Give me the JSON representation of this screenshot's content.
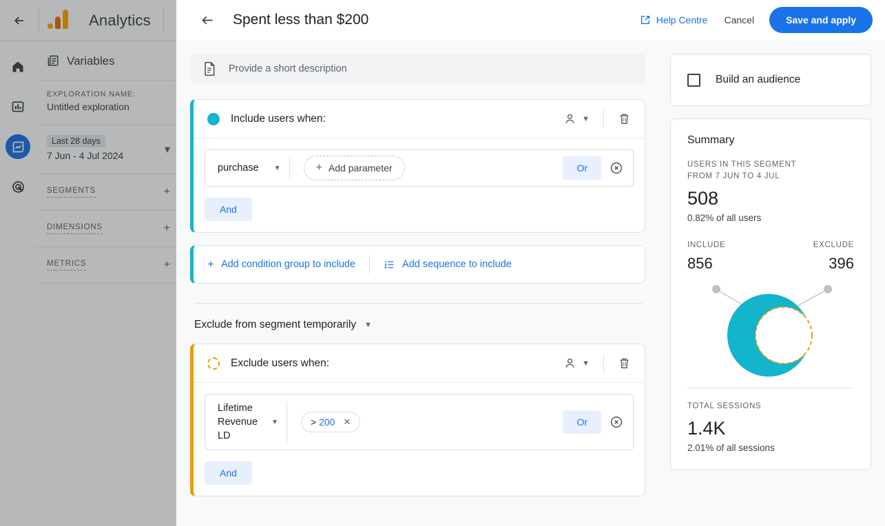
{
  "app": {
    "back_label": "back-arrow",
    "brand": "Analytics",
    "rail": [
      {
        "name": "home-icon",
        "label": "Home"
      },
      {
        "name": "reports-icon",
        "label": "Reports"
      },
      {
        "name": "explore-icon",
        "label": "Explore"
      },
      {
        "name": "advertising-icon",
        "label": "Advertising"
      }
    ],
    "variables": {
      "header": "Variables",
      "exploration_name_label": "EXPLORATION NAME:",
      "exploration_name_value": "Untitled exploration",
      "date_chip": "Last 28 days",
      "date_range": "7 Jun - 4 Jul 2024",
      "sections": [
        "SEGMENTS",
        "DIMENSIONS",
        "METRICS"
      ]
    }
  },
  "modal": {
    "title": "Spent less than $200",
    "help_label": "Help Centre",
    "cancel_label": "Cancel",
    "save_label": "Save and apply",
    "description_placeholder": "Provide a short description"
  },
  "include_group": {
    "header_label": "Include users when:",
    "scope_icon": "person-icon",
    "delete_icon": "trash-icon",
    "condition": {
      "dimension": "purchase",
      "add_parameter_label": "Add parameter",
      "or_label": "Or",
      "remove_label": "remove-condition"
    },
    "and_label": "And"
  },
  "add_group_bar": {
    "add_condition_group_label": "Add condition group to include",
    "add_sequence_label": "Add sequence to include"
  },
  "exclude_select": {
    "value": "Exclude from segment temporarily"
  },
  "exclude_group": {
    "header_label": "Exclude users when:",
    "scope_icon": "person-icon",
    "delete_icon": "trash-icon",
    "condition": {
      "dimension": "Lifetime Revenue LD",
      "value_operator": ">",
      "value_number": "200",
      "or_label": "Or",
      "remove_label": "remove-condition"
    },
    "and_label": "And"
  },
  "right_panel": {
    "audience_label": "Build an audience",
    "summary_title": "Summary",
    "users_label_line1": "USERS IN THIS SEGMENT",
    "users_label_line2": "FROM 7 JUN TO 4 JUL",
    "users_value": "508",
    "users_note": "0.82% of all users",
    "include_label": "INCLUDE",
    "include_value": "856",
    "exclude_label": "EXCLUDE",
    "exclude_value": "396",
    "sessions_label": "TOTAL SESSIONS",
    "sessions_value": "1.4K",
    "sessions_note": "2.01% of all sessions"
  },
  "colors": {
    "brand_blue": "#1a73e8",
    "include_teal": "#12b5cb",
    "exclude_orange": "#f29900",
    "chip_blue_bg": "#e8f0fe",
    "page_bg": "#f8f9fa"
  }
}
